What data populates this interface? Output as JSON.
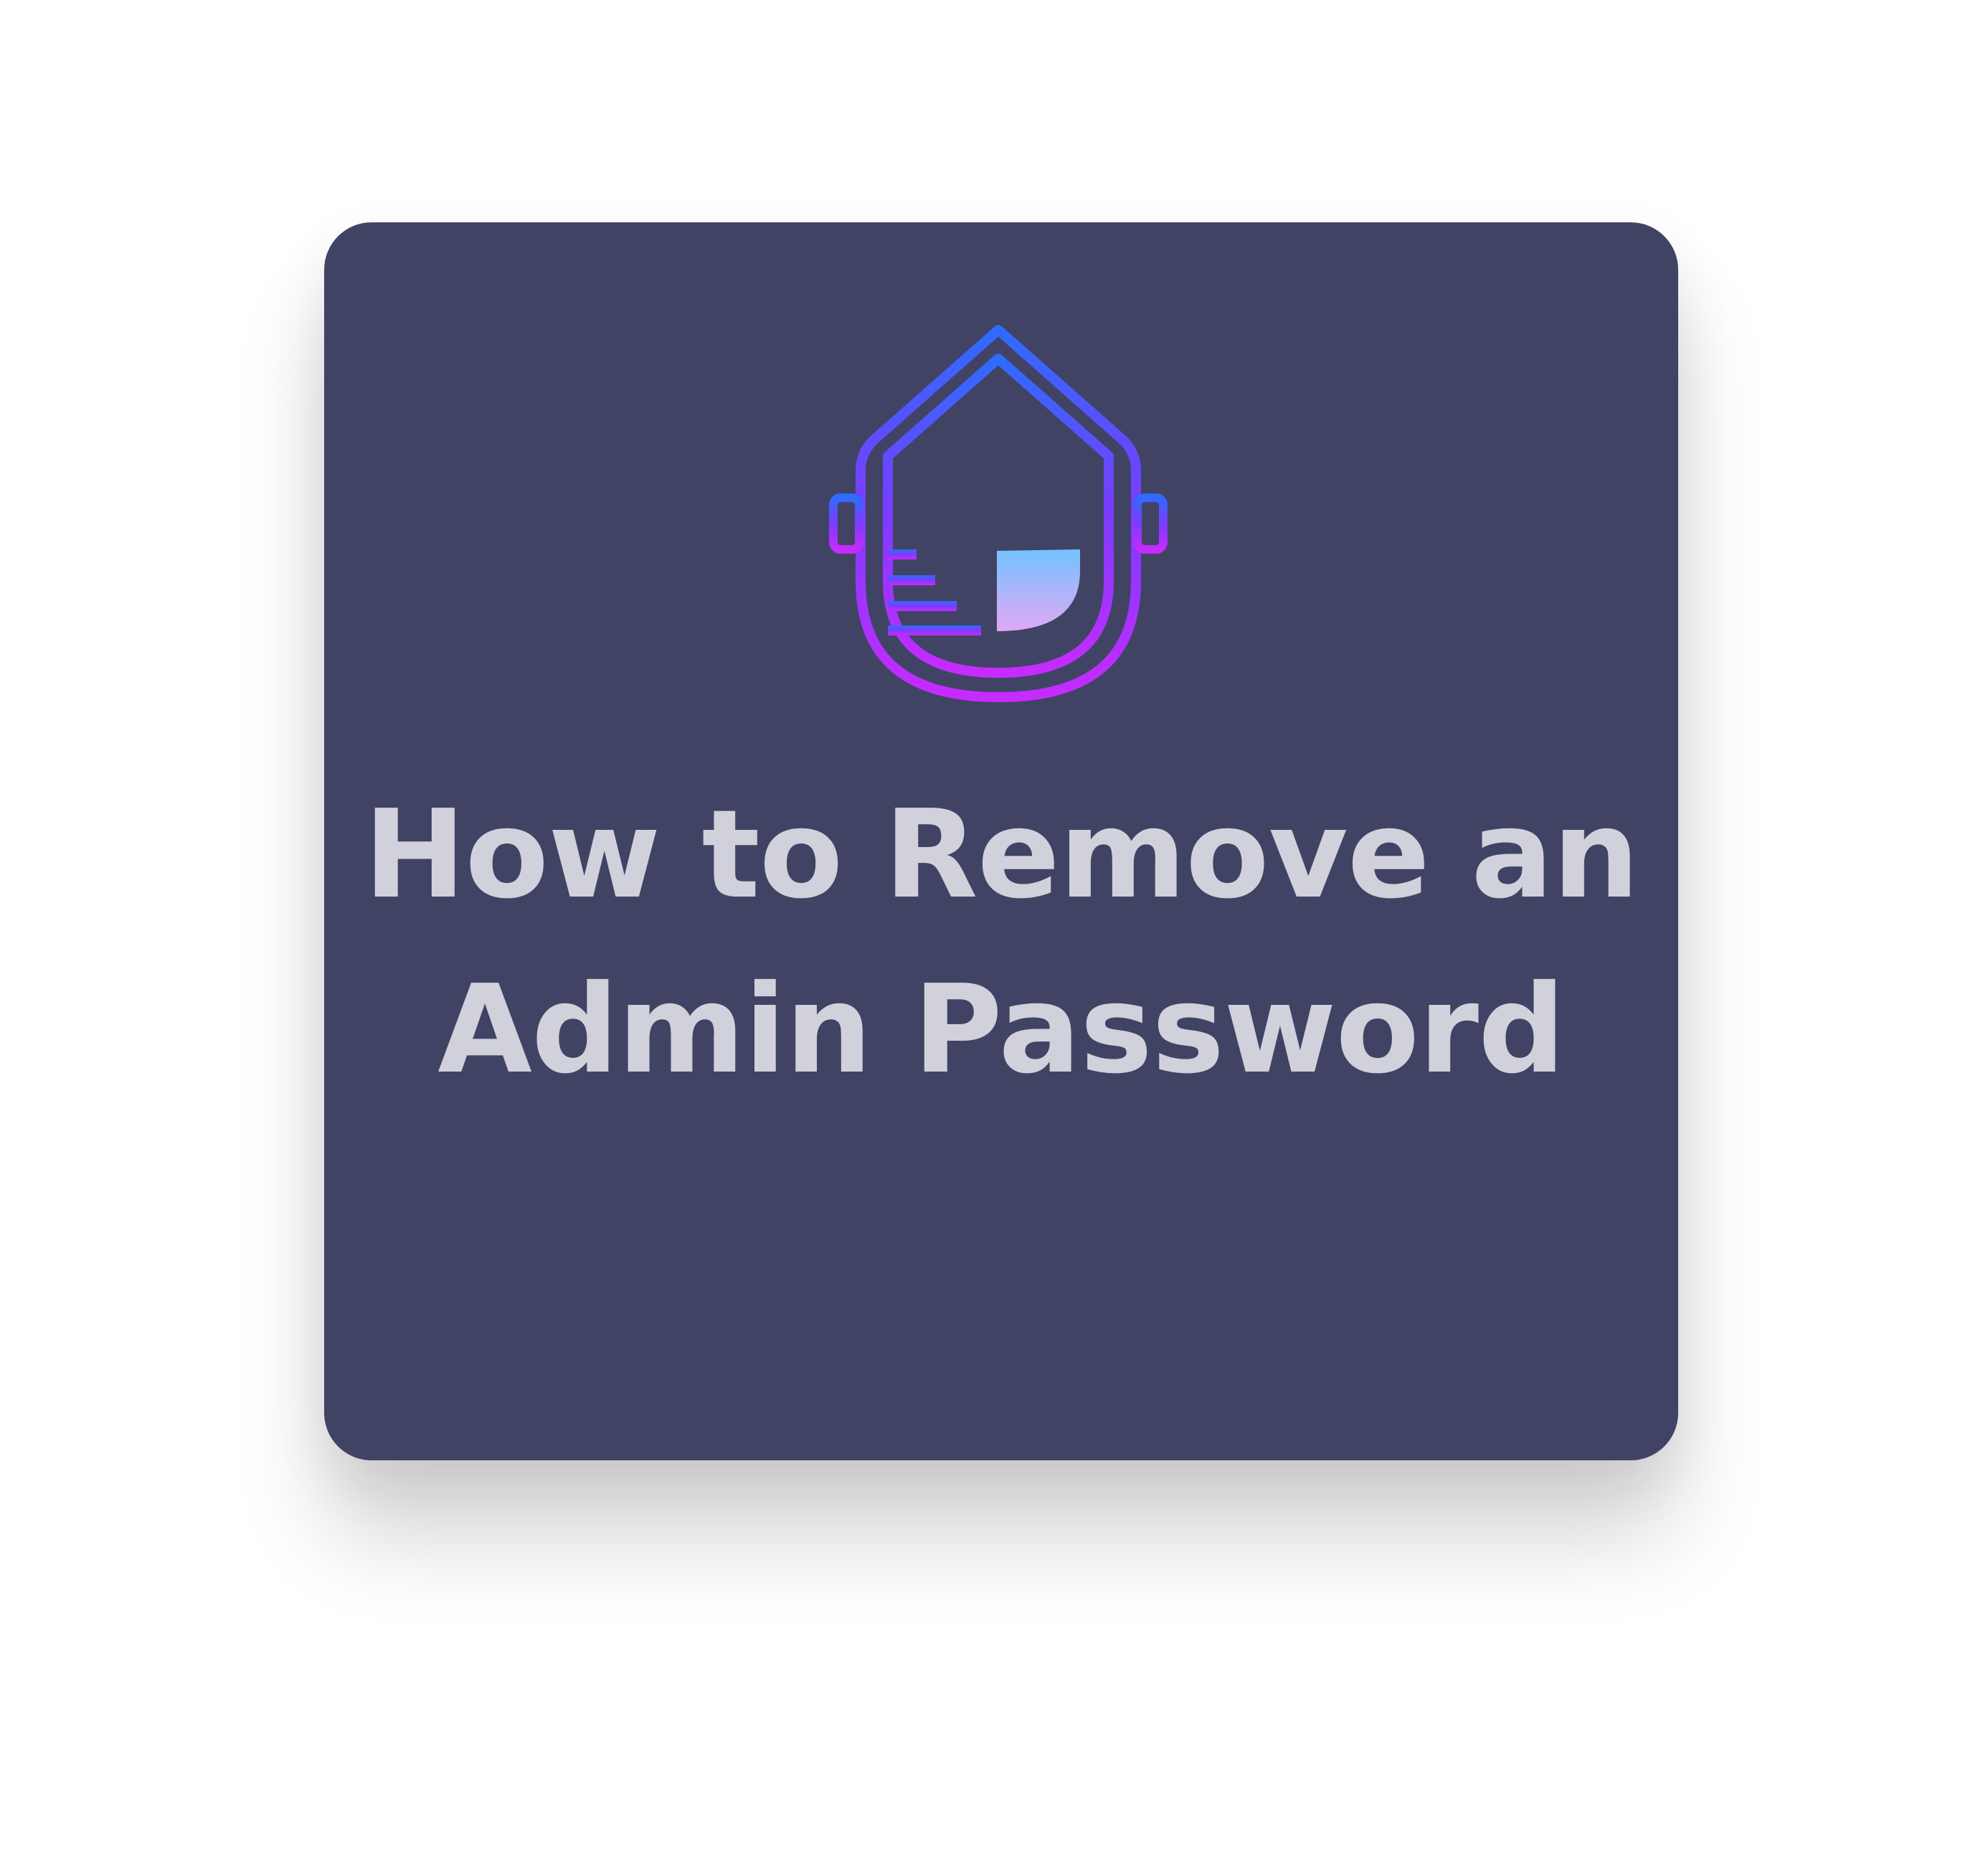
{
  "card": {
    "icon": "home-security-icon",
    "title_line_1": "How to Remove an",
    "title_line_2": "Admin Password"
  },
  "colors": {
    "card_background": "#414365",
    "title_text": "#D1D1DC",
    "icon_gradient_top": "#2F6BFF",
    "icon_gradient_mid": "#7A3CFF",
    "icon_gradient_bottom": "#C62BFF",
    "icon_fill_top": "#73C2FF",
    "icon_fill_bottom": "#E1A8F5"
  }
}
